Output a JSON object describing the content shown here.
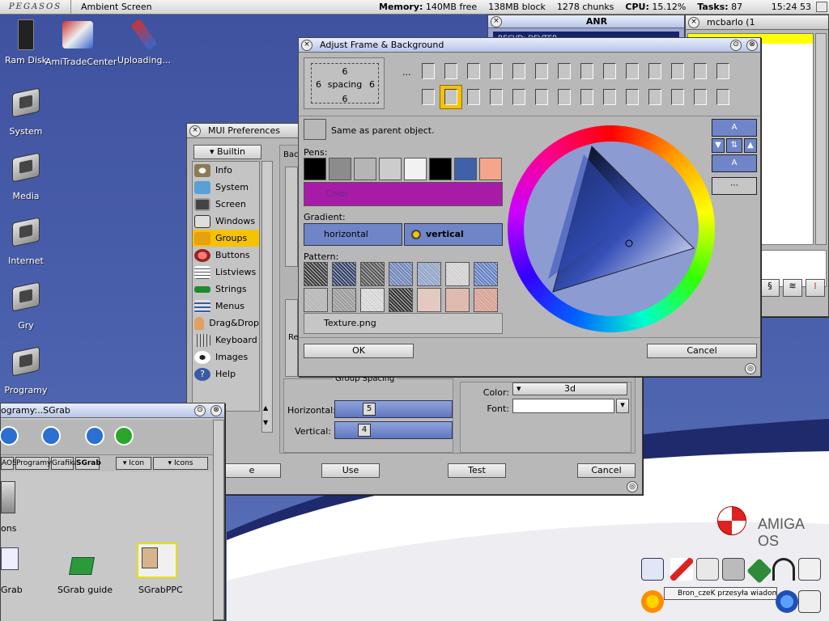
{
  "screenbar": {
    "logo": "PEGASOS",
    "screen_title": "Ambient Screen",
    "memory_label": "Memory:",
    "memory_free": "140MB free",
    "block": "138MB block",
    "chunks": "1278 chunks",
    "cpu_label": "CPU:",
    "cpu_value": "15.12%",
    "tasks_label": "Tasks:",
    "tasks_value": "87",
    "clock": "15:24 53"
  },
  "desktop_icons": {
    "ram_disk": "Ram Disk",
    "amitrade": "AmiTradeCenter",
    "uploading": "Uploading...",
    "system": "System",
    "media": "Media",
    "internet": "Internet",
    "gry": "Gry",
    "programy": "Programy"
  },
  "mui_prefs": {
    "title": "MUI Preferences",
    "list_header": "Builtin",
    "items": [
      "Info",
      "System",
      "Screen",
      "Windows",
      "Groups",
      "Buttons",
      "Listviews",
      "Strings",
      "Menus",
      "Drag&Drop",
      "Keyboard",
      "Images",
      "Help"
    ],
    "background_label": "Back",
    "re_label": "Re",
    "spacing_label": "Group Spacing",
    "horizontal_label": "Horizontal:",
    "horizontal_value": "5",
    "vertical_label": "Vertical:",
    "vertical_value": "4",
    "color_label": "Color:",
    "color_value": "3d",
    "font_label": "Font:",
    "font_value": "",
    "save_button": "e",
    "use_button": "Use",
    "test_button": "Test",
    "cancel_button": "Cancel"
  },
  "adjust": {
    "title": "Adjust Frame & Background",
    "spacing_top": "6",
    "spacing_left": "6",
    "spacing_word": "spacing",
    "spacing_right": "6",
    "spacing_bottom": "6",
    "ellipsis": "...",
    "same_as_parent": "Same as parent object.",
    "pens_label": "Pens:",
    "color_bar_label": "Color",
    "gradient_label": "Gradient:",
    "gradient_horizontal": "horizontal",
    "gradient_vertical": "vertical",
    "pattern_label": "Pattern:",
    "texture_file": "Texture.png",
    "ok_button": "OK",
    "cancel_button": "Cancel",
    "side_label_a": "A",
    "side_label_b": "A",
    "colors": {
      "selected_frame": "#f5c300",
      "color_bar": "#a81ba8",
      "gradient_btn": "#6f85c8"
    },
    "pens": [
      "#000000",
      "#8c8c8c",
      "#b5b5b5",
      "#cccccc",
      "#f2f2f2",
      "#000000",
      "#3f61a8",
      "#f5a58c"
    ],
    "patterns_row1": [
      "#3a3a3a",
      "#2f3f6b",
      "#555555",
      "#6a86bf",
      "#8fa6d0",
      "#dcdcdc",
      "#5f7fcf"
    ],
    "patterns_row2": [
      "#b8b8b8",
      "#9a9a9a",
      "#e2e2e2",
      "#303030",
      "#edc9bd",
      "#e6b4a2",
      "#e2a090"
    ]
  },
  "mcbarlo": {
    "title": "mcbarlo (1"
  },
  "anr": {
    "label": "ANR",
    "recvd": "RECVD: DEVTER"
  },
  "sgrab": {
    "title": "ogramy:..SGrab",
    "tab_aos": "AOS",
    "tab_programy": "Programy:",
    "tab_grafika": "Grafika",
    "tab_sgrab": "SGrab",
    "icon_label": "Icon",
    "icons_label": "Icons",
    "ons": "ons",
    "grab": "Grab",
    "sgrab_guide": "SGrab guide",
    "sgrabppc": "SGrabPPC"
  },
  "branding": {
    "amiga_os": "AMIGA OS"
  },
  "notify": {
    "message": "Bron_czeK przesyła wiadomość"
  }
}
